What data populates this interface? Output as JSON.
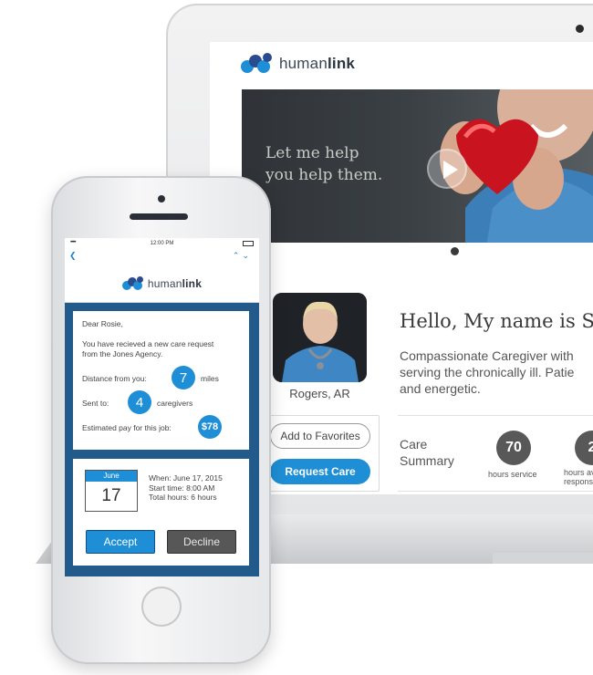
{
  "laptop": {
    "brand": {
      "name_light": "human",
      "name_bold": "link"
    },
    "hero": {
      "line1": "Let me help",
      "line2": "you help them."
    },
    "profile": {
      "location": "Rogers, AR",
      "greeting": "Hello, My name is Sa",
      "bio_line1": "Compassionate Caregiver with",
      "bio_line2": "serving the chronically ill. Patie",
      "bio_line3": "and energetic.",
      "add_favorites_label": "Add to Favorites",
      "request_care_label": "Request Care"
    },
    "summary": {
      "title_line1": "Care",
      "title_line2": "Summary",
      "stats": [
        {
          "value": "70",
          "label": "hours service"
        },
        {
          "value": "2",
          "label_line1": "hours av",
          "label_line2": "respons"
        }
      ]
    }
  },
  "phone": {
    "status_time": "12:00 PM",
    "brand": {
      "name_light": "human",
      "name_bold": "link"
    },
    "message": {
      "greeting": "Dear Rosie,",
      "line1": "You have recieved a new care request",
      "line2": "from the Jones Agency.",
      "distance_label": "Distance from you:",
      "distance_value": "7",
      "distance_unit": "miles",
      "sent_label": "Sent to:",
      "sent_value": "4",
      "sent_unit": "caregivers",
      "pay_label": "Estimated pay for this job:",
      "pay_value": "$78"
    },
    "job": {
      "cal_month": "June",
      "cal_day": "17",
      "when": "When: June 17, 2015",
      "start": "Start time: 8:00 AM",
      "hours": "Total hours: 6 hours",
      "accept_label": "Accept",
      "decline_label": "Decline"
    }
  },
  "colors": {
    "accent_blue": "#1e8fd6",
    "phone_frame_blue": "#235a8c",
    "stat_gray": "#585858",
    "decline_gray": "#575757",
    "hero_dark": "#2f3337"
  }
}
